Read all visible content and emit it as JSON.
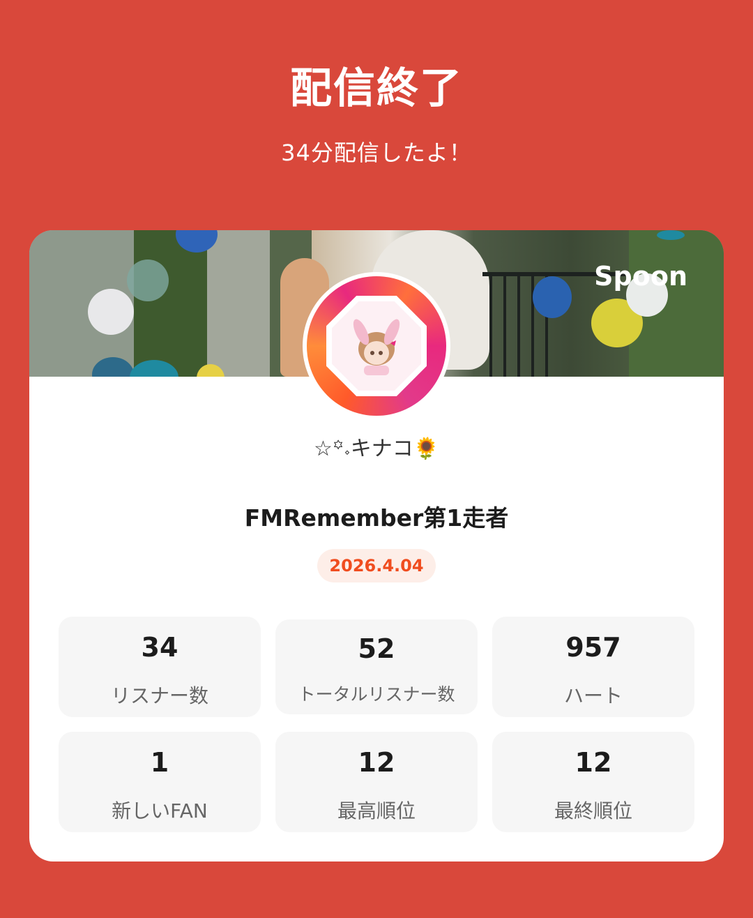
{
  "header": {
    "title": "配信終了",
    "subtitle": "34分配信したよ！"
  },
  "banner": {
    "logo_text": "Spoon"
  },
  "profile": {
    "nickname": "☆꙳𝆹キナコ🌻",
    "live_title": "FMRemember第1走者",
    "date": "2026.4.04"
  },
  "stats": [
    {
      "value": "34",
      "label": "リスナー数"
    },
    {
      "value": "52",
      "label": "トータルリスナー数"
    },
    {
      "value": "957",
      "label": "ハート"
    },
    {
      "value": "1",
      "label": "新しいFAN"
    },
    {
      "value": "12",
      "label": "最高順位"
    },
    {
      "value": "12",
      "label": "最終順位"
    }
  ],
  "colors": {
    "background": "#d9483b",
    "card": "#ffffff",
    "date_text": "#f04d1f",
    "date_badge_bg": "#fdeee8",
    "stat_box": "#f6f6f6"
  }
}
